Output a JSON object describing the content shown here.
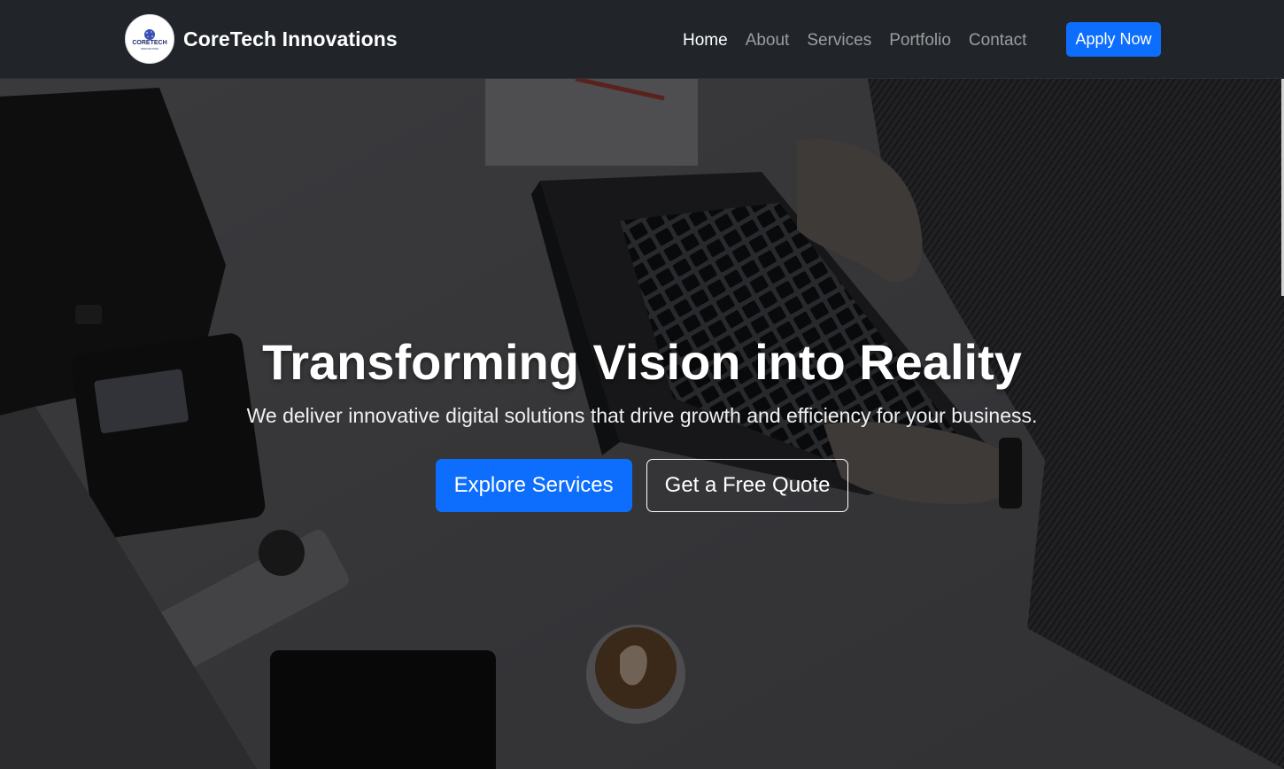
{
  "navbar": {
    "brand_name": "CoreTech Innovations",
    "logo_text": "CORETECH",
    "logo_sub": "INNOVATIONS",
    "links": [
      "Home",
      "About",
      "Services",
      "Portfolio",
      "Contact"
    ],
    "active_link": "Home",
    "apply_label": "Apply Now"
  },
  "hero": {
    "title": "Transforming Vision into Reality",
    "subtitle": "We deliver innovative digital solutions that drive growth and efficiency for your business.",
    "primary_button": "Explore Services",
    "secondary_button": "Get a Free Quote",
    "background_description_icon": "office-desk-photo"
  },
  "colors": {
    "navbar_bg": "#212529",
    "accent": "#0d6efd",
    "text_light": "#ffffff",
    "nav_inactive": "rgba(255,255,255,0.55)"
  }
}
